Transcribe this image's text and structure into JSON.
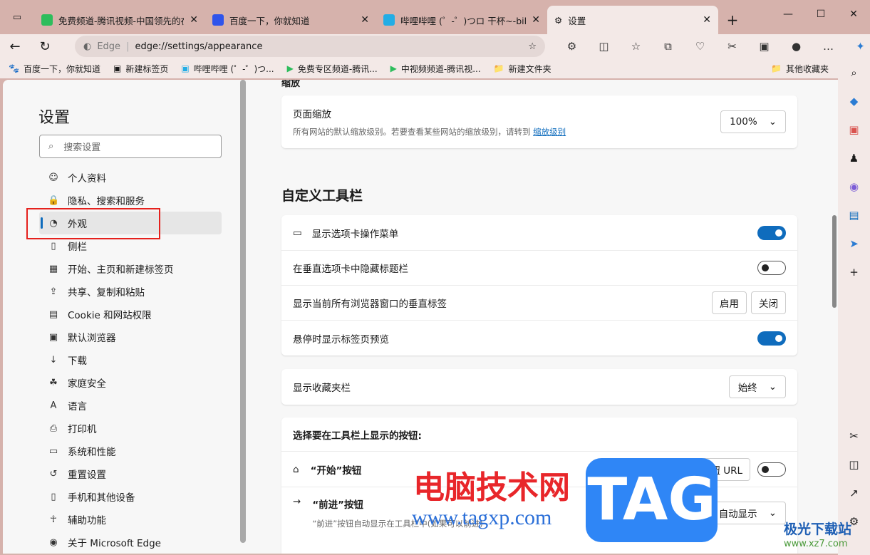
{
  "tabs": [
    {
      "title": "免费频道-腾讯视频-中国领先的在",
      "icon": "tencent-video-icon"
    },
    {
      "title": "百度一下，你就知道",
      "icon": "baidu-icon"
    },
    {
      "title": "哔哩哔哩 (゜-゜)つロ 干杯~-bilib",
      "icon": "bilibili-icon"
    },
    {
      "title": "设置",
      "icon": "gear-icon"
    }
  ],
  "address": {
    "site": "Edge",
    "url": "edge://settings/appearance"
  },
  "bookmarks": [
    "百度一下，你就知道",
    "新建标签页",
    "哔哩哔哩 (゜-゜)つ...",
    "免费专区频道-腾讯...",
    "中视频频道-腾讯视...",
    "新建文件夹"
  ],
  "other_bookmarks": "其他收藏夹",
  "sidebar": {
    "title": "设置",
    "search_placeholder": "搜索设置",
    "items": [
      "个人资料",
      "隐私、搜索和服务",
      "外观",
      "侧栏",
      "开始、主页和新建标签页",
      "共享、复制和粘贴",
      "Cookie 和网站权限",
      "默认浏览器",
      "下载",
      "家庭安全",
      "语言",
      "打印机",
      "系统和性能",
      "重置设置",
      "手机和其他设备",
      "辅助功能",
      "关于 Microsoft Edge"
    ],
    "selected": "外观"
  },
  "zoom": {
    "section": "缩放",
    "label": "页面缩放",
    "desc": "所有网站的默认缩放级别。若要查看某些网站的缩放级别，请转到",
    "link": "缩放级别",
    "value": "100%"
  },
  "toolbar": {
    "title": "自定义工具栏",
    "show_tab_actions": "显示选项卡操作菜单",
    "hide_title_bar": "在垂直选项卡中隐藏标题栏",
    "vertical_tabs": "显示当前所有浏览器窗口的垂直标签",
    "enable": "启用",
    "close": "关闭",
    "hover_preview": "悬停时显示标签页预览",
    "favorites_bar": "显示收藏夹栏",
    "favorites_value": "始终",
    "choose_buttons": "选择要在工具栏上显示的按钮:",
    "home_button": "“开始”按钮",
    "set_url": "设置按钮 URL",
    "forward_button": "“前进”按钮",
    "forward_value": "自动显示",
    "forward_desc": "“前进”按钮自动显示在工具栏中(如果可以前进)"
  },
  "toggles": {
    "show_tab_actions": true,
    "hide_title_bar": false,
    "hover_preview": true,
    "home_button": false
  },
  "watermark": {
    "text": "电脑技术网",
    "url": "www.tagxp.com",
    "logo": "TAG",
    "site": "极光下载站",
    "site_url": "www.xz7.com"
  }
}
